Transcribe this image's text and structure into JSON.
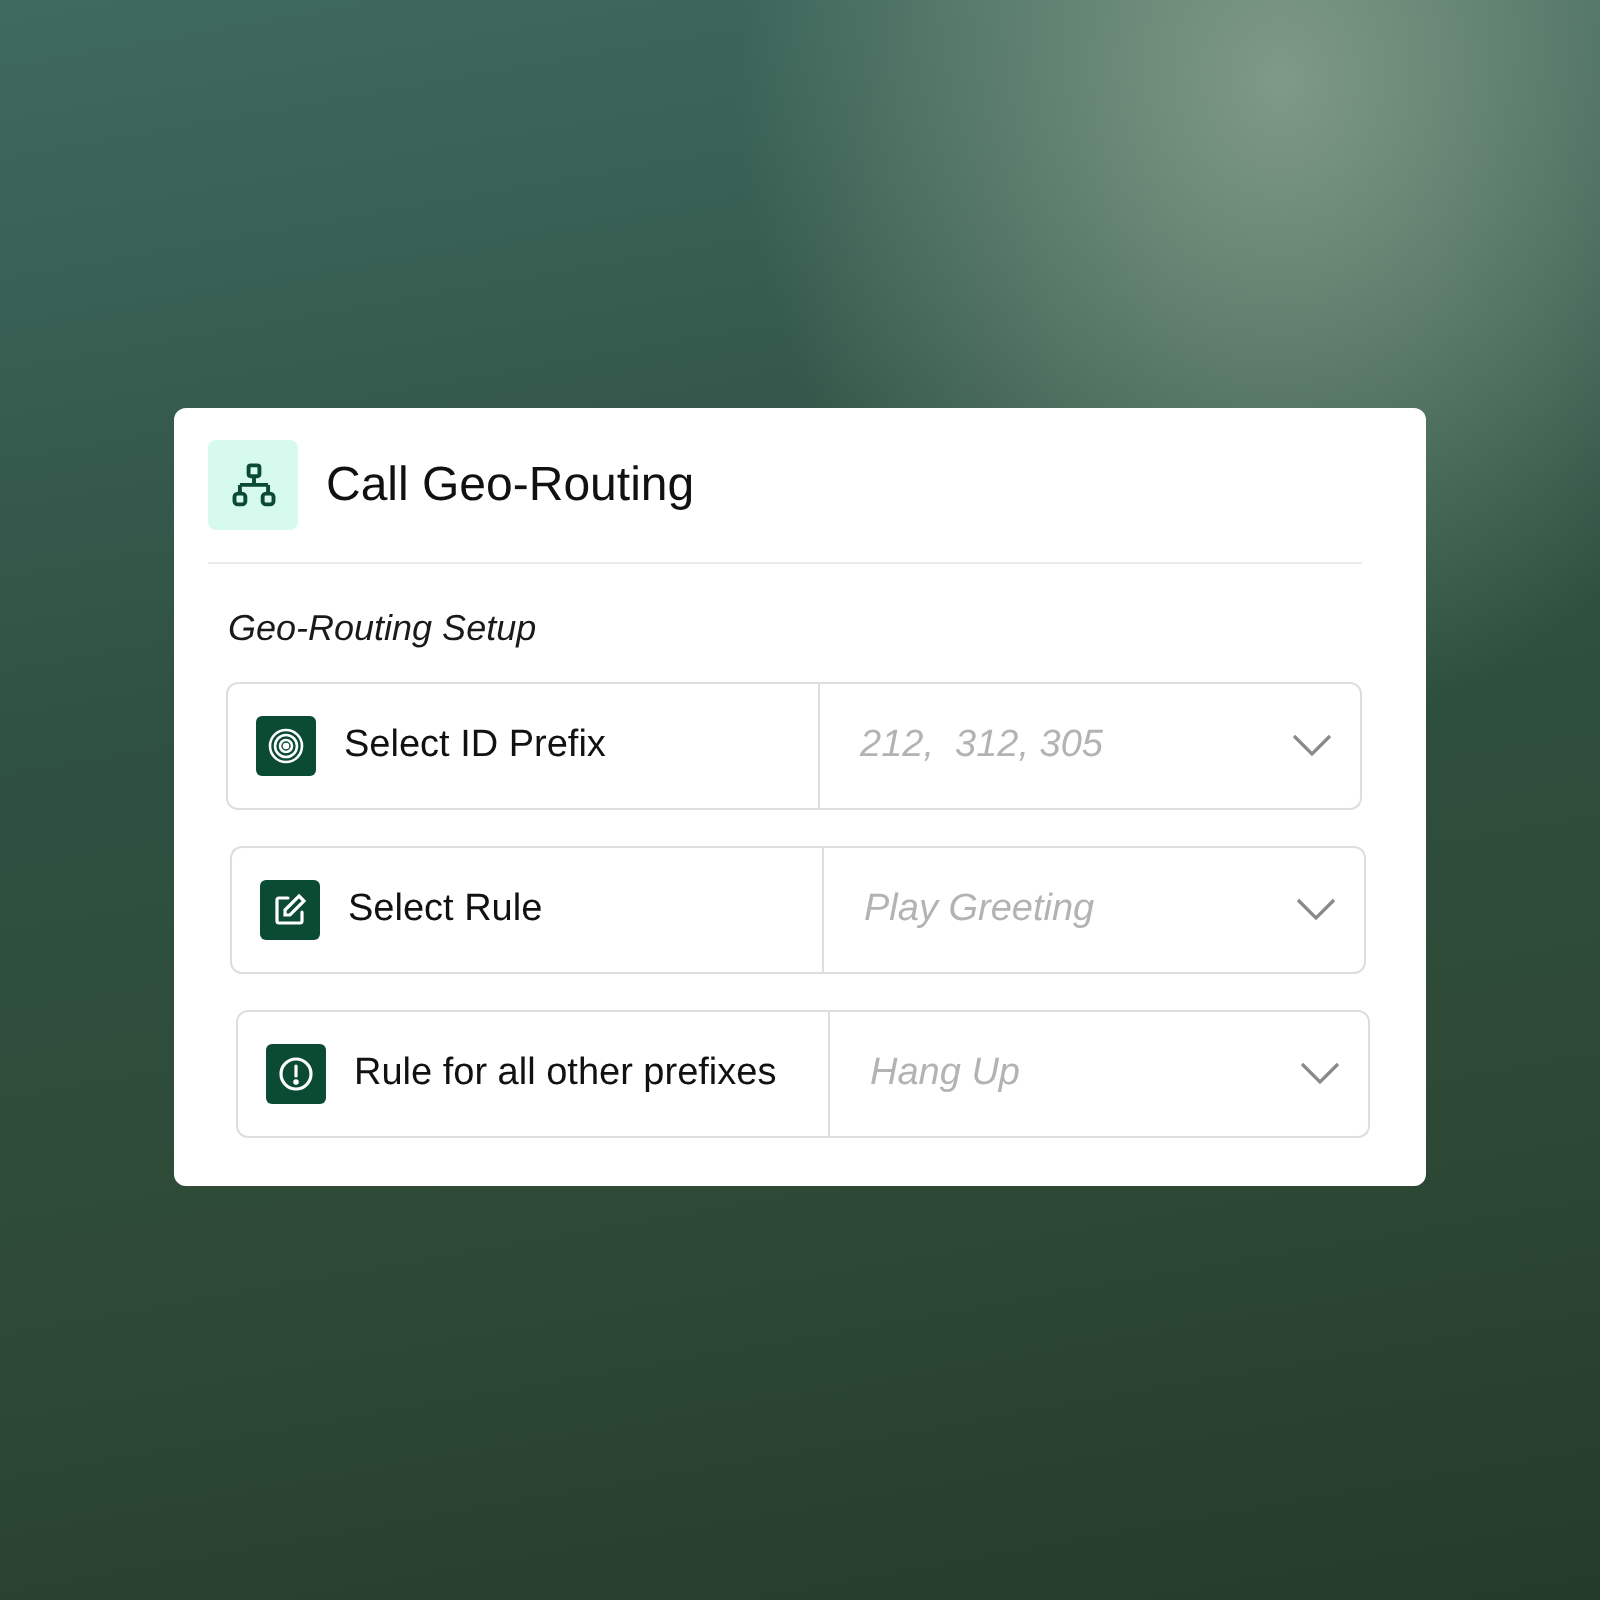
{
  "card": {
    "title": "Call Geo-Routing",
    "section": "Geo-Routing Setup",
    "rows": [
      {
        "label": "Select ID Prefix",
        "placeholder": "212,  312, 305"
      },
      {
        "label": "Select Rule",
        "placeholder": "Play Greeting"
      },
      {
        "label": "Rule for all other prefixes",
        "placeholder": "Hang Up"
      }
    ]
  }
}
